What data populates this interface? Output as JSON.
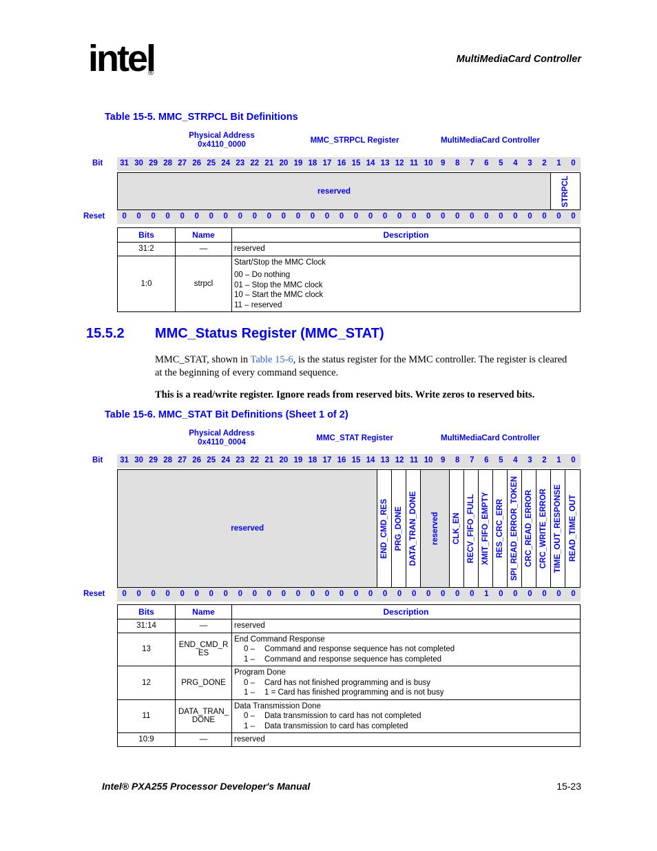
{
  "header": {
    "logo_text": "intel",
    "logo_registered": "®",
    "running_head": "MultiMediaCard Controller"
  },
  "footer": {
    "manual_title": "Intel® PXA255 Processor Developer's Manual",
    "page_number": "15-23"
  },
  "colors": {
    "heading_blue": "#0000ff",
    "link_blue": "#3366cc",
    "shade_gray": "#e0e0e0",
    "text_black": "#000000"
  },
  "table_5": {
    "caption": "Table 15-5. MMC_STRPCL Bit Definitions",
    "meta": {
      "phys_addr_label": "Physical Address",
      "phys_addr_value": "0x4110_0000",
      "register_name": "MMC_STRPCL Register",
      "unit_name": "MultiMediaCard Controller"
    },
    "bit_label": "Bit",
    "reset_label": "Reset",
    "bits": [
      "31",
      "30",
      "29",
      "28",
      "27",
      "26",
      "25",
      "24",
      "23",
      "22",
      "21",
      "20",
      "19",
      "18",
      "17",
      "16",
      "15",
      "14",
      "13",
      "12",
      "11",
      "10",
      "9",
      "8",
      "7",
      "6",
      "5",
      "4",
      "3",
      "2",
      "1",
      "0"
    ],
    "reset_values": [
      "0",
      "0",
      "0",
      "0",
      "0",
      "0",
      "0",
      "0",
      "0",
      "0",
      "0",
      "0",
      "0",
      "0",
      "0",
      "0",
      "0",
      "0",
      "0",
      "0",
      "0",
      "0",
      "0",
      "0",
      "0",
      "0",
      "0",
      "0",
      "0",
      "0",
      "0",
      "0"
    ],
    "fields": [
      {
        "name": "reserved",
        "span": 30,
        "reserved": true,
        "orient": "horizontal"
      },
      {
        "name": "STRPCL",
        "span": 2,
        "reserved": false,
        "orient": "vertical"
      }
    ],
    "desc_headers": [
      "Bits",
      "Name",
      "Description"
    ],
    "rows": [
      {
        "bits": "31:2",
        "name": "—",
        "title": "reserved",
        "options": []
      },
      {
        "bits": "1:0",
        "name": "strpcl",
        "title": "Start/Stop the MMC Clock",
        "options": [
          "00 – Do nothing",
          "01 – Stop the MMC clock",
          "10 – Start the MMC clock",
          "11 – reserved"
        ]
      }
    ]
  },
  "section": {
    "number": "15.5.2",
    "title": "MMC_Status Register (MMC_STAT)",
    "para1_a": "MMC_STAT, shown in ",
    "para1_link": "Table 15-6",
    "para1_b": ", is the status register for the MMC controller. The register is cleared at the beginning of every command sequence.",
    "para2": "This is a read/write register. Ignore reads from reserved bits. Write zeros to reserved bits."
  },
  "table_6": {
    "caption": "Table 15-6. MMC_STAT Bit Definitions (Sheet 1 of 2)",
    "meta": {
      "phys_addr_label": "Physical Address",
      "phys_addr_value": "0x4110_0004",
      "register_name": "MMC_STAT Register",
      "unit_name": "MultiMediaCard Controller"
    },
    "bit_label": "Bit",
    "reset_label": "Reset",
    "bits": [
      "31",
      "30",
      "29",
      "28",
      "27",
      "26",
      "25",
      "24",
      "23",
      "22",
      "21",
      "20",
      "19",
      "18",
      "17",
      "16",
      "15",
      "14",
      "13",
      "12",
      "11",
      "10",
      "9",
      "8",
      "7",
      "6",
      "5",
      "4",
      "3",
      "2",
      "1",
      "0"
    ],
    "reset_values": [
      "0",
      "0",
      "0",
      "0",
      "0",
      "0",
      "0",
      "0",
      "0",
      "0",
      "0",
      "0",
      "0",
      "0",
      "0",
      "0",
      "0",
      "0",
      "0",
      "0",
      "0",
      "0",
      "0",
      "0",
      "0",
      "1",
      "0",
      "0",
      "0",
      "0",
      "0",
      "0"
    ],
    "fields": [
      {
        "name": "reserved",
        "span": 18,
        "reserved": true,
        "orient": "horizontal"
      },
      {
        "name": "END_CMD_RES",
        "span": 1,
        "reserved": false,
        "orient": "vertical"
      },
      {
        "name": "PRG_DONE",
        "span": 1,
        "reserved": false,
        "orient": "vertical"
      },
      {
        "name": "DATA_TRAN_DONE",
        "span": 1,
        "reserved": false,
        "orient": "vertical"
      },
      {
        "name": "reserved",
        "span": 2,
        "reserved": true,
        "orient": "vertical"
      },
      {
        "name": "CLK_EN",
        "span": 1,
        "reserved": false,
        "orient": "vertical"
      },
      {
        "name": "RECV_FIFO_FULL",
        "span": 1,
        "reserved": false,
        "orient": "vertical"
      },
      {
        "name": "XMIT_FIFO_EMPTY",
        "span": 1,
        "reserved": false,
        "orient": "vertical"
      },
      {
        "name": "RES_CRC_ERR",
        "span": 1,
        "reserved": false,
        "orient": "vertical"
      },
      {
        "name": "SPI_READ_ERROR_TOKEN",
        "span": 1,
        "reserved": false,
        "orient": "vertical"
      },
      {
        "name": "CRC_READ_ERROR",
        "span": 1,
        "reserved": false,
        "orient": "vertical"
      },
      {
        "name": "CRC_WRITE_ERROR",
        "span": 1,
        "reserved": false,
        "orient": "vertical"
      },
      {
        "name": "TIME_OUT_RESPONSE",
        "span": 1,
        "reserved": false,
        "orient": "vertical"
      },
      {
        "name": "READ_TIME_OUT",
        "span": 1,
        "reserved": false,
        "orient": "vertical"
      }
    ],
    "desc_headers": [
      "Bits",
      "Name",
      "Description"
    ],
    "rows": [
      {
        "bits": "31:14",
        "name": "—",
        "title": "reserved",
        "options": []
      },
      {
        "bits": "13",
        "name": "END_CMD_R ES",
        "title": "End Command Response",
        "options": [
          "0 – Command and response sequence has not completed",
          "1 – Command and response sequence has completed"
        ]
      },
      {
        "bits": "12",
        "name": "PRG_DONE",
        "title": "Program Done",
        "options": [
          "0 – Card has not finished programming and is busy",
          "1 – 1 = Card has finished programming and is not busy"
        ]
      },
      {
        "bits": "11",
        "name": "DATA_TRAN_ DONE",
        "title": "Data Transmission Done",
        "options": [
          "0 – Data transmission to card has not completed",
          "1 – Data transmission to card has completed"
        ]
      },
      {
        "bits": "10:9",
        "name": "—",
        "title": "reserved",
        "options": []
      }
    ]
  }
}
